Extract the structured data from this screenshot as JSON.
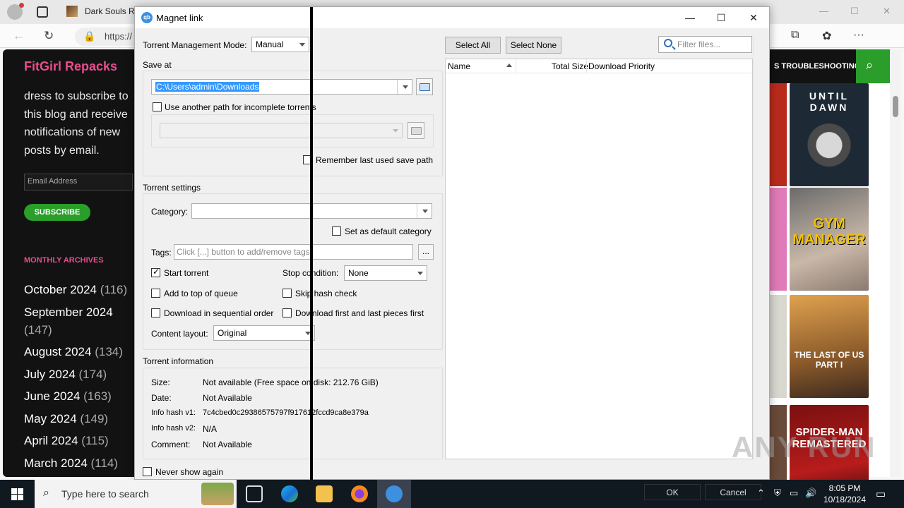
{
  "browser": {
    "tab_title": "Dark Souls Re",
    "address": "https://",
    "window_controls": [
      "—",
      "☐",
      "✕"
    ]
  },
  "site": {
    "logo": "FitGirl Repacks",
    "subscribe_text": "dress to subscribe to this blog and receive notifications of new posts by email.",
    "email_placeholder": "Email Address",
    "subscribe_button": "SUBSCRIBE",
    "archives_title": "MONTHLY ARCHIVES",
    "archives": [
      {
        "month": "October 2024",
        "count": "(116)"
      },
      {
        "month": "September 2024",
        "count": "(147)"
      },
      {
        "month": "August 2024",
        "count": "(134)"
      },
      {
        "month": "July 2024",
        "count": "(174)"
      },
      {
        "month": "June 2024",
        "count": "(163)"
      },
      {
        "month": "May 2024",
        "count": "(149)"
      },
      {
        "month": "April 2024",
        "count": "(115)"
      },
      {
        "month": "March 2024",
        "count": "(114)"
      }
    ],
    "nav_right": "S TROUBLESHOOTING",
    "thumbnails": [
      {
        "title": "UNTIL DAWN"
      },
      {
        "title": "GYM MANAGER"
      },
      {
        "title": "THE LAST OF US PART I"
      },
      {
        "title": "SPIDER-MAN REMASTERED"
      }
    ],
    "watermark": "ANY RUN"
  },
  "dialog": {
    "title": "Magnet link",
    "mode_label": "Torrent Management Mode:",
    "mode_value": "Manual",
    "save_at_label": "Save at",
    "save_path": "C:\\Users\\admin\\Downloads",
    "incomplete_label": "Use another path for incomplete torrents",
    "remember_label": "Remember last used save path",
    "torrent_settings_label": "Torrent settings",
    "category_label": "Category:",
    "category_value": "",
    "default_category_label": "Set as default category",
    "tags_label": "Tags:",
    "tags_placeholder": "Click [...] button to add/remove tags.",
    "tags_button": "...",
    "start_torrent_label": "Start torrent",
    "start_torrent_checked": true,
    "stop_condition_label": "Stop condition:",
    "stop_condition_value": "None",
    "add_top_label": "Add to top of queue",
    "skip_hash_label": "Skip hash check",
    "sequential_label": "Download in sequential order",
    "first_last_label": "Download first and last pieces first",
    "content_layout_label": "Content layout:",
    "content_layout_value": "Original",
    "info_title": "Torrent information",
    "info": [
      {
        "key": "Size:",
        "value": "Not available (Free space on disk: 212.76 GiB)"
      },
      {
        "key": "Date:",
        "value": "Not Available"
      },
      {
        "key": "Info hash v1:",
        "value": "7c4cbed0c29386575797f917612fccd9ca8e379a"
      },
      {
        "key": "Info hash v2:",
        "value": "N/A"
      },
      {
        "key": "Comment:",
        "value": "Not Available"
      }
    ],
    "never_show_label": "Never show again",
    "select_all": "Select All",
    "select_none": "Select None",
    "filter_placeholder": "Filter files...",
    "columns": [
      "Name",
      "Total Size",
      "Download Priority"
    ],
    "ok_button": "OK",
    "cancel_button": "Cancel"
  },
  "taskbar": {
    "search_placeholder": "Type here to search",
    "time": "8:05 PM",
    "date": "10/18/2024"
  }
}
